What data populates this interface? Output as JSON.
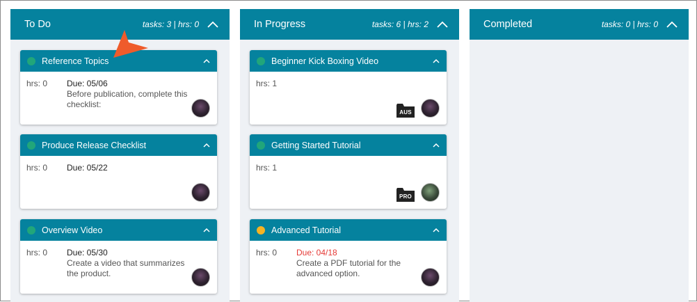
{
  "colors": {
    "accent": "#05829e",
    "status_green": "#21a67a",
    "status_orange": "#f5b324",
    "overdue_red": "#e53935",
    "pointer": "#ef5b2b"
  },
  "columns": [
    {
      "title": "To Do",
      "stats": "tasks: 3 | hrs: 0",
      "cards": [
        {
          "title": "Reference Topics",
          "status": "green",
          "hrs": "hrs: 0",
          "due": "Due: 05/06",
          "overdue": false,
          "desc": "Before publication, complete this checklist:",
          "tag": "",
          "avatar": "avatar-user"
        },
        {
          "title": "Produce Release Checklist",
          "status": "green",
          "hrs": "hrs: 0",
          "due": "Due: 05/22",
          "overdue": false,
          "desc": "",
          "tag": "",
          "avatar": "avatar-user"
        },
        {
          "title": "Overview Video",
          "status": "green",
          "hrs": "hrs: 0",
          "due": "Due: 05/30",
          "overdue": false,
          "desc": "Create a video that summarizes the product.",
          "tag": "",
          "avatar": "avatar-user"
        }
      ]
    },
    {
      "title": "In Progress",
      "stats": "tasks: 6 | hrs: 2",
      "cards": [
        {
          "title": "Beginner Kick Boxing Video",
          "status": "green",
          "hrs": "hrs: 1",
          "due": "",
          "overdue": false,
          "desc": "",
          "tag": "AUS",
          "avatar": "avatar-user"
        },
        {
          "title": "Getting Started Tutorial",
          "status": "green",
          "hrs": "hrs: 1",
          "due": "",
          "overdue": false,
          "desc": "",
          "tag": "PRO",
          "avatar": "avatar-user-alt"
        },
        {
          "title": "Advanced Tutorial",
          "status": "orange",
          "hrs": "hrs: 0",
          "due": "Due: 04/18",
          "overdue": true,
          "desc": "Create a PDF tutorial for the advanced option.",
          "tag": "",
          "avatar": "avatar-user"
        }
      ]
    },
    {
      "title": "Completed",
      "stats": "tasks: 0 | hrs: 0",
      "cards": []
    }
  ],
  "icons": {
    "column_collapse": "chevron-up-icon",
    "card_collapse": "chevron-up-icon",
    "tag": "folder-tag-icon",
    "pointer": "arrow-pointer-icon"
  }
}
